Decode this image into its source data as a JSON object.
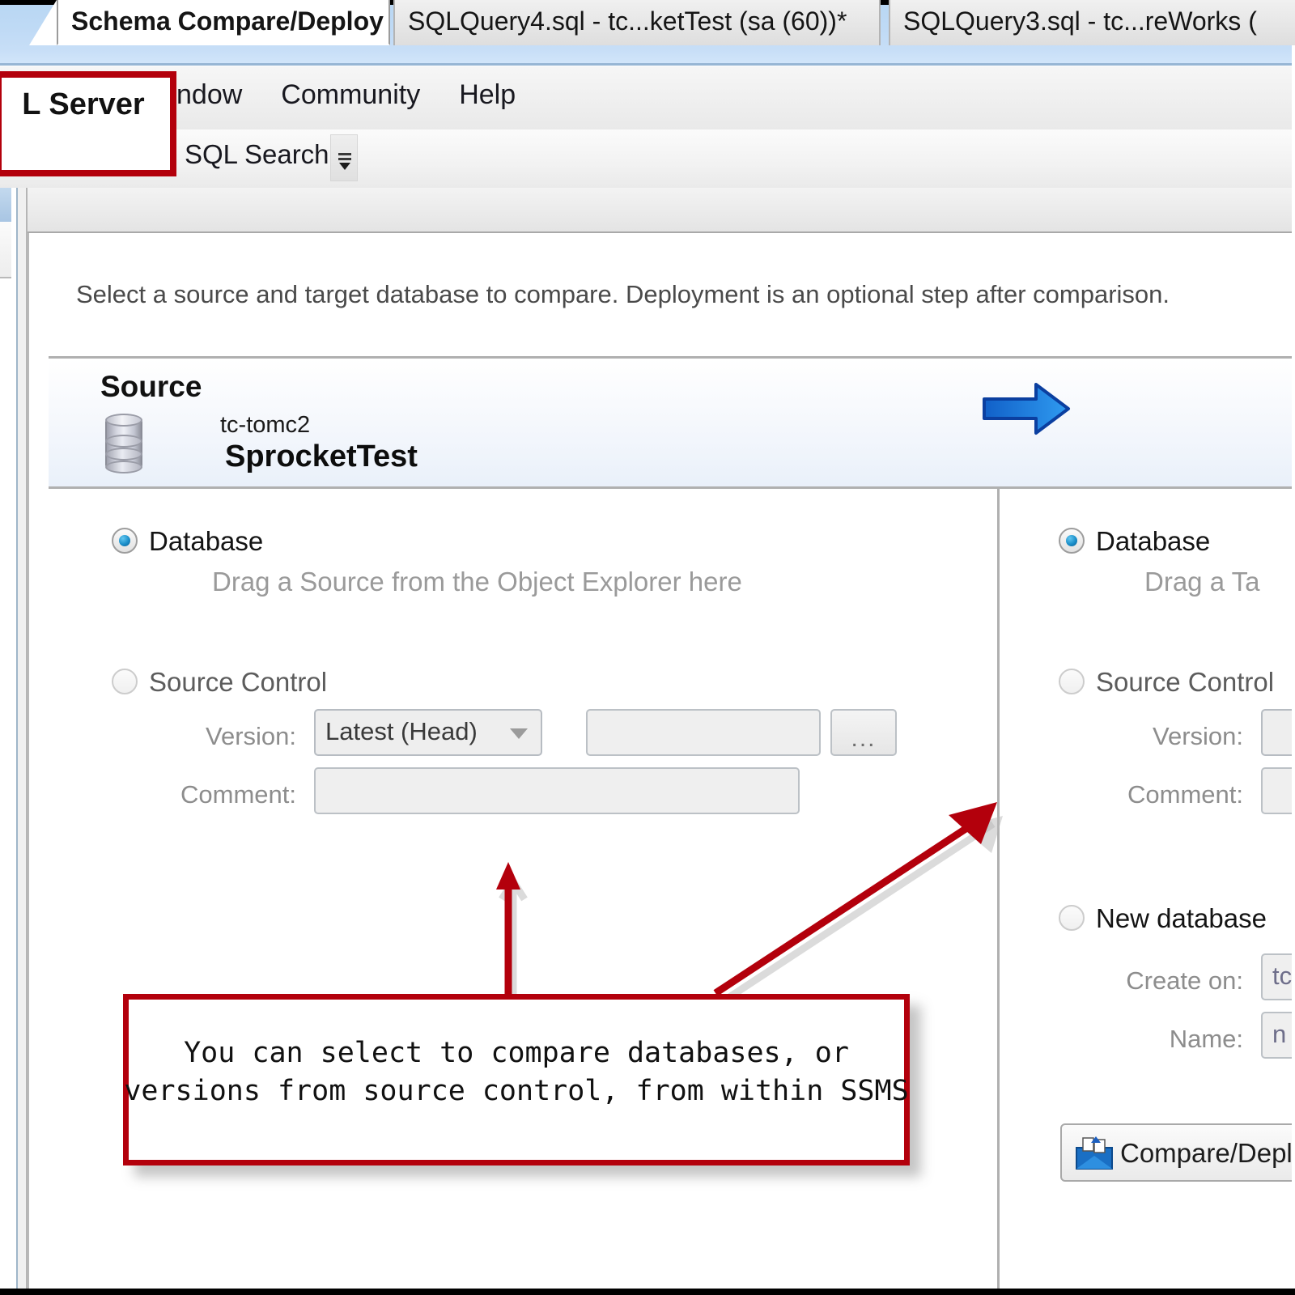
{
  "window": {
    "titlebar_color": "#bfdaf5"
  },
  "menu": {
    "items": [
      "ndow",
      "Community",
      "Help"
    ]
  },
  "toolbar": {
    "sql_search_label": "SQL Search",
    "overflow_icon": "toolbar-overflow-icon"
  },
  "tabs": [
    {
      "label": "Schema Compare/Deploy",
      "active": true
    },
    {
      "label": "SQLQuery4.sql - tc...ketTest (sa (60))*",
      "active": false
    },
    {
      "label": "SQLQuery3.sql - tc...reWorks (",
      "active": false
    }
  ],
  "page": {
    "intro": "Select a source and target database to compare. Deployment is an optional step after comparison.",
    "arrow_icon": "blue-right-arrow-icon",
    "accent_red": "#b3000c",
    "accent_blue": "#1565d8"
  },
  "source": {
    "heading": "Source",
    "db_icon": "database-cylinder-icon",
    "server": "tc-tomc2",
    "database": "SprocketTest",
    "database_option": {
      "label": "Database",
      "selected": true,
      "drag_hint": "Drag a Source from the Object Explorer here"
    },
    "source_control_option": {
      "label": "Source Control",
      "selected": false,
      "version_label": "Version:",
      "version_value": "Latest (Head)",
      "path_value": "",
      "browse_label": "...",
      "comment_label": "Comment:",
      "comment_value": ""
    }
  },
  "target": {
    "database_option": {
      "label": "Database",
      "selected": true,
      "drag_hint": "Drag a Ta"
    },
    "source_control_option": {
      "label": "Source Control",
      "selected": false,
      "version_label": "Version:",
      "comment_label": "Comment:"
    },
    "new_database_option": {
      "label": "New database",
      "selected": false,
      "create_on_label": "Create on:",
      "create_on_value": "tc",
      "name_label": "Name:",
      "name_value": "n"
    },
    "compare_button": {
      "label": "Compare/Deplo",
      "icon": "compare-deploy-icon"
    }
  },
  "annotations": {
    "top_left_box_text": "L Server",
    "callout_text": "You can select to compare databases, or\nversions from source control, from within SSMS",
    "arrow_up_icon": "red-up-arrow-icon",
    "arrow_diagonal_icon": "red-diagonal-arrow-icon"
  }
}
